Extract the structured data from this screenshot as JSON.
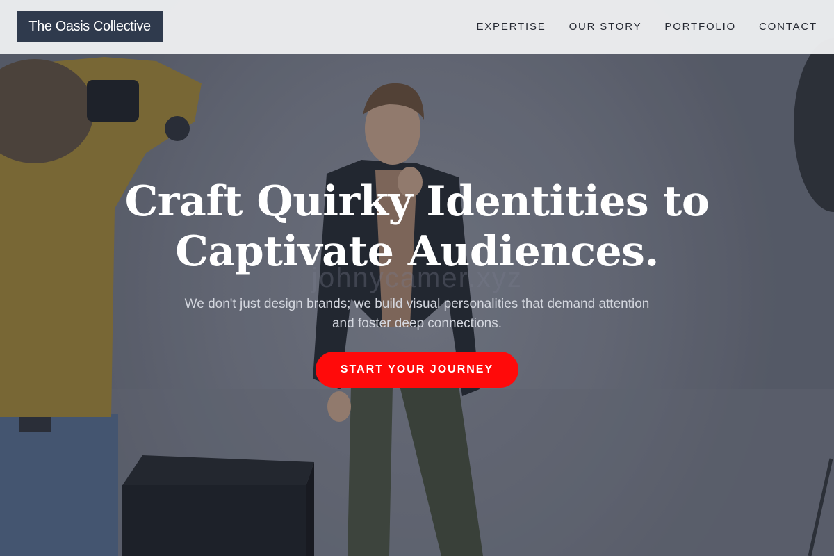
{
  "header": {
    "brand": "The Oasis Collective",
    "nav": [
      {
        "label": "EXPERTISE"
      },
      {
        "label": "OUR STORY"
      },
      {
        "label": "PORTFOLIO"
      },
      {
        "label": "CONTACT"
      }
    ]
  },
  "hero": {
    "title_line1": "Craft Quirky Identities to",
    "title_line2": "Captivate Audiences.",
    "subtitle": "We don't just design brands; we build visual personalities that demand attention and foster deep connections.",
    "cta_label": "START YOUR JOURNEY",
    "background_image": "photographer-shooting-model-icon",
    "watermark": "johnycamer.xyz"
  },
  "colors": {
    "brand_bg": "#2f3a4d",
    "header_bg": "#ecedef",
    "cta": "#ff0a0a",
    "title": "#ffffff",
    "subtitle": "#d4d7df"
  }
}
